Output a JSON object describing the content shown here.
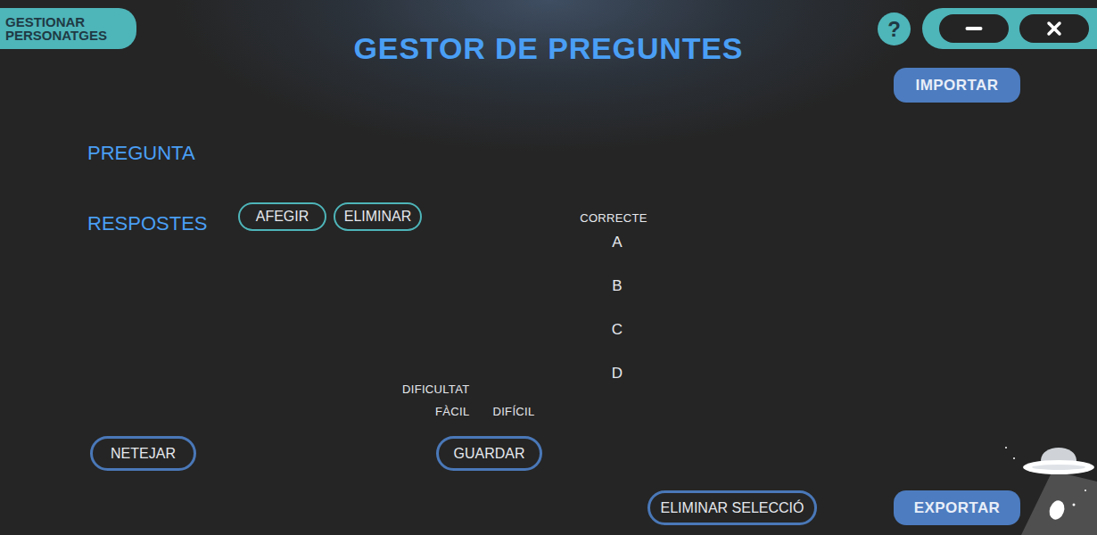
{
  "header": {
    "manage_button": "GESTIONAR PERSONATGES",
    "title": "GESTOR DE PREGUNTES",
    "help": "?"
  },
  "import_button": "IMPORTAR",
  "question": {
    "label": "PREGUNTA"
  },
  "answers": {
    "label": "RESPOSTES",
    "add_button": "AFEGIR",
    "remove_button": "ELIMINAR",
    "correct_label": "CORRECTE",
    "options": [
      {
        "letter": "A",
        "selected": false
      },
      {
        "letter": "B",
        "selected": false
      },
      {
        "letter": "C",
        "selected": false
      },
      {
        "letter": "D",
        "selected": false
      }
    ]
  },
  "difficulty": {
    "label": "DIFICULTAT",
    "options": [
      {
        "label": "FÀCIL",
        "selected": false
      },
      {
        "label": "DIFÍCIL",
        "selected": false
      }
    ]
  },
  "clear_button": "NETEJAR",
  "save_button": "GUARDAR",
  "delete_selection_button": "ELIMINAR SELECCIÓ",
  "export_button": "EXPORTAR"
}
